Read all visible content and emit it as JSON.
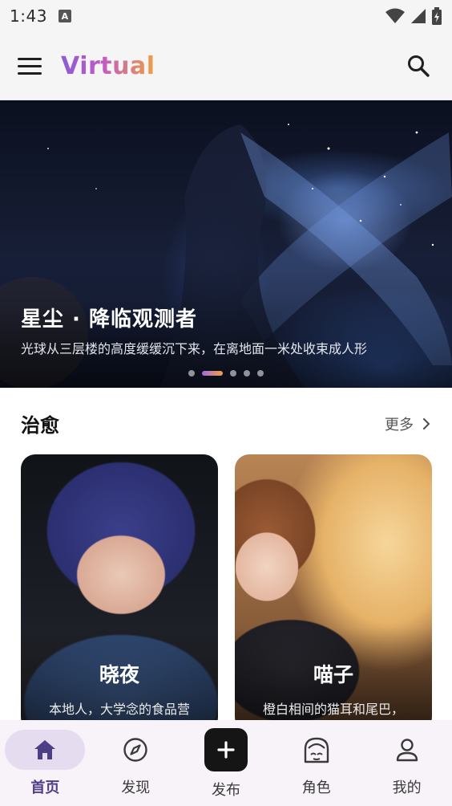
{
  "status_bar": {
    "time": "1:43",
    "notification_letter": "A"
  },
  "app_bar": {
    "brand": "Virtual",
    "menu_icon": "menu-icon",
    "search_icon": "search-icon"
  },
  "hero": {
    "title": "星尘 · 降临观测者",
    "subtitle": "光球从三层楼的高度缓缓沉下来，在离地面一米处收束成人形",
    "slide_count": 5,
    "active_slide": 2
  },
  "section": {
    "title": "治愈",
    "more_label": "更多"
  },
  "cards": [
    {
      "name": "晓夜",
      "desc": "本地人，大学念的食品营"
    },
    {
      "name": "喵子",
      "desc": "橙白相间的猫耳和尾巴，"
    }
  ],
  "bottom_nav": {
    "items": [
      {
        "label": "首页",
        "icon": "home-icon",
        "active": true
      },
      {
        "label": "发现",
        "icon": "compass-icon",
        "active": false
      },
      {
        "label": "发布",
        "icon": "plus-icon",
        "active": false
      },
      {
        "label": "角色",
        "icon": "character-icon",
        "active": false
      },
      {
        "label": "我的",
        "icon": "person-icon",
        "active": false
      }
    ]
  },
  "colors": {
    "brand_start": "#8e5ad8",
    "brand_end": "#f0a040",
    "nav_active": "#4d3f86",
    "nav_active_bg": "#e5ddef"
  }
}
